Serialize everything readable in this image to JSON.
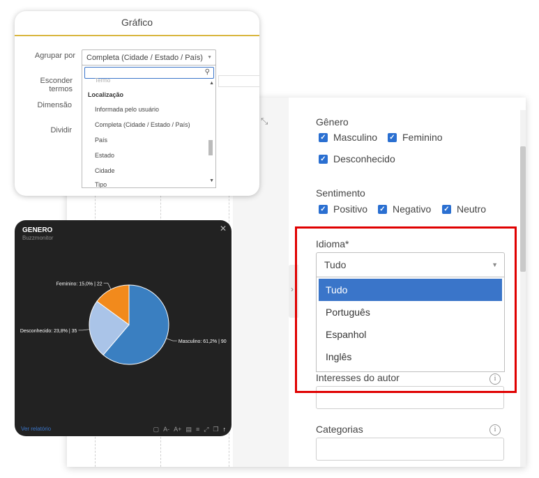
{
  "grafico_card": {
    "title": "Gráfico",
    "labels": {
      "group_by": "Agrupar por",
      "hide_terms": "Esconder termos",
      "dimension": "Dimensão",
      "split": "Dividir"
    },
    "group_by_value": "Completa (Cidade / Estado / País)",
    "group_list": {
      "partial_top": "Termo",
      "section_header": "Localização",
      "items": [
        "Informada pelo usuário",
        "Completa (Cidade / Estado / País)",
        "País",
        "Estado",
        "Cidade"
      ],
      "partial_bottom": "Tipo"
    }
  },
  "chart_card": {
    "title": "GENERO",
    "subtitle": "Buzzmonitor",
    "report_link": "Ver relatório",
    "tool_labels": [
      "A-",
      "A+"
    ]
  },
  "chart_data": {
    "type": "pie",
    "title": "GENERO",
    "subtitle": "Buzzmonitor",
    "slices": [
      {
        "label": "Masculino: 61,2% | 90",
        "name": "Masculino",
        "value": 90,
        "percent": 61.2,
        "color": "#3a7fc1"
      },
      {
        "label": "Desconhecido: 23,8% | 35",
        "name": "Desconhecido",
        "value": 35,
        "percent": 23.8,
        "color": "#aac4e8"
      },
      {
        "label": "Feminino: 15,0% | 22",
        "name": "Feminino",
        "value": 22,
        "percent": 15.0,
        "color": "#f28a1c"
      }
    ]
  },
  "filters": {
    "gender": {
      "title": "Gênero",
      "options": [
        {
          "label": "Masculino",
          "checked": true
        },
        {
          "label": "Feminino",
          "checked": true
        },
        {
          "label": "Desconhecido",
          "checked": true
        }
      ]
    },
    "sentiment": {
      "title": "Sentimento",
      "options": [
        {
          "label": "Positivo",
          "checked": true
        },
        {
          "label": "Negativo",
          "checked": true
        },
        {
          "label": "Neutro",
          "checked": true
        }
      ]
    },
    "language": {
      "title": "Idioma*",
      "value": "Tudo",
      "options": [
        "Tudo",
        "Português",
        "Espanhol",
        "Inglês"
      ],
      "selected": "Tudo"
    },
    "author_interests": {
      "title": "Interesses do autor"
    },
    "categories": {
      "title": "Categorias"
    }
  },
  "colors": {
    "accent_blue": "#3a75c9",
    "checkbox_blue": "#2a6fd1",
    "highlight_red": "#e00000",
    "gold_rule": "#d9b63f",
    "chart_bg": "#222222"
  }
}
